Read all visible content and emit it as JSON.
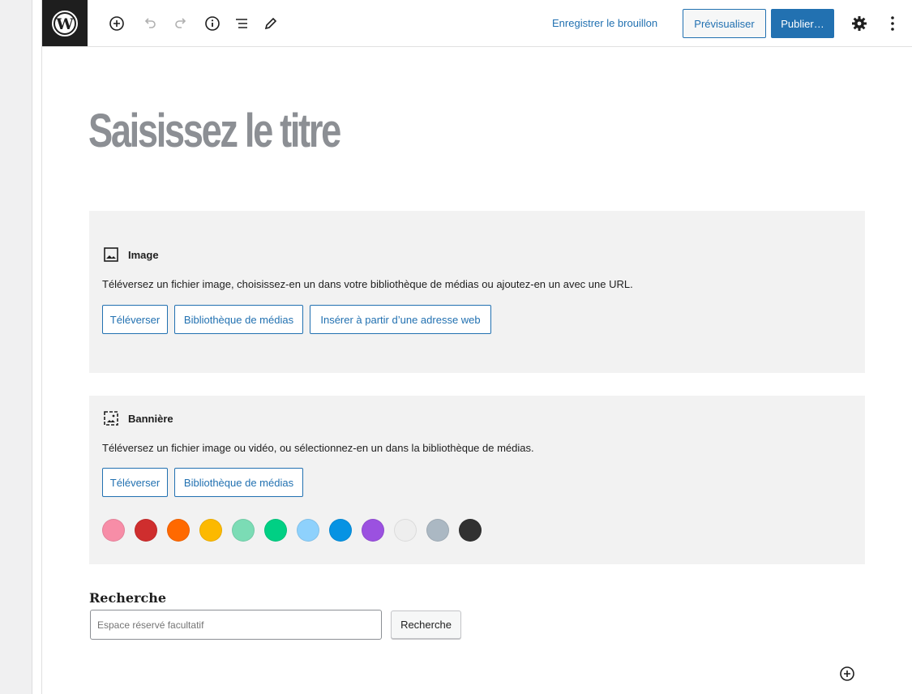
{
  "toolbar": {
    "icons": [
      "wordpress-logo",
      "add-block-icon",
      "undo-icon",
      "redo-icon",
      "info-icon",
      "list-view-icon",
      "edit-tool-icon",
      "settings-icon",
      "more-options-icon"
    ],
    "save_draft_label": "Enregistrer le brouillon",
    "preview_label": "Prévisualiser",
    "publish_label": "Publier…"
  },
  "editor": {
    "title_placeholder": "Saisissez le titre"
  },
  "image_block": {
    "label": "Image",
    "description": "Téléversez un fichier image, choisissez-en un dans votre bibliothèque de médias ou ajoutez-en un avec une URL.",
    "buttons": [
      "Téléverser",
      "Bibliothèque de médias",
      "Insérer à partir d’une adresse web"
    ]
  },
  "banner_block": {
    "label": "Bannière",
    "description": "Téléversez un fichier image ou vidéo, ou sélectionnez-en un dans la bibliothèque de médias.",
    "buttons": [
      "Téléverser",
      "Bibliothèque de médias"
    ],
    "colors": [
      "#f78da7",
      "#cf2e2e",
      "#ff6900",
      "#fcb900",
      "#7bdcb5",
      "#00d084",
      "#8ed1fc",
      "#0693e3",
      "#9b51e0",
      "#eeeeee",
      "#abb8c3",
      "#313131"
    ]
  },
  "search_block": {
    "label": "Recherche",
    "placeholder": "Espace réservé facultatif",
    "button_label": "Recherche"
  },
  "colors": {
    "accent": "#2271b1",
    "title_gray": "#8c8f94",
    "block_bg": "#f2f2f2"
  }
}
